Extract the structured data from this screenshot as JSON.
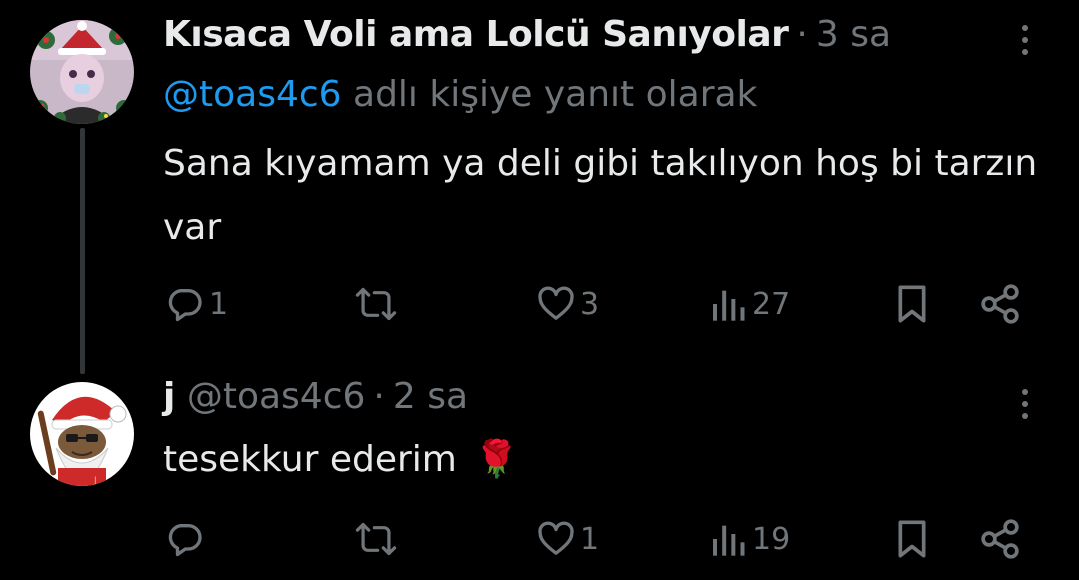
{
  "tweets": [
    {
      "display_name": "Kısaca Voli ama Lolcü Sanıyolar",
      "separator": "·",
      "time": "3 sa",
      "reply_to_handle": "@toas4c6",
      "reply_to_suffix": " adlı kişiye yanıt olarak",
      "text": "Sana kıyamam ya deli gibi takılıyon hoş bi tarzın var",
      "replies": "1",
      "retweets": "",
      "likes": "3",
      "views": "27"
    },
    {
      "display_name": "j",
      "handle": "@toas4c6",
      "separator": "·",
      "time": "2 sa",
      "text": "tesekkur ederim",
      "emoji": "🌹",
      "replies": "",
      "retweets": "",
      "likes": "1",
      "views": "19"
    }
  ],
  "icons": {
    "reply": "reply-icon",
    "retweet": "retweet-icon",
    "like": "like-icon",
    "views": "views-icon",
    "bookmark": "bookmark-icon",
    "share": "share-icon",
    "more": "more-icon"
  },
  "colors": {
    "background": "#000000",
    "text": "#e7e9ea",
    "muted": "#71767b",
    "link": "#1d9bf0",
    "thread_line": "#333639"
  }
}
